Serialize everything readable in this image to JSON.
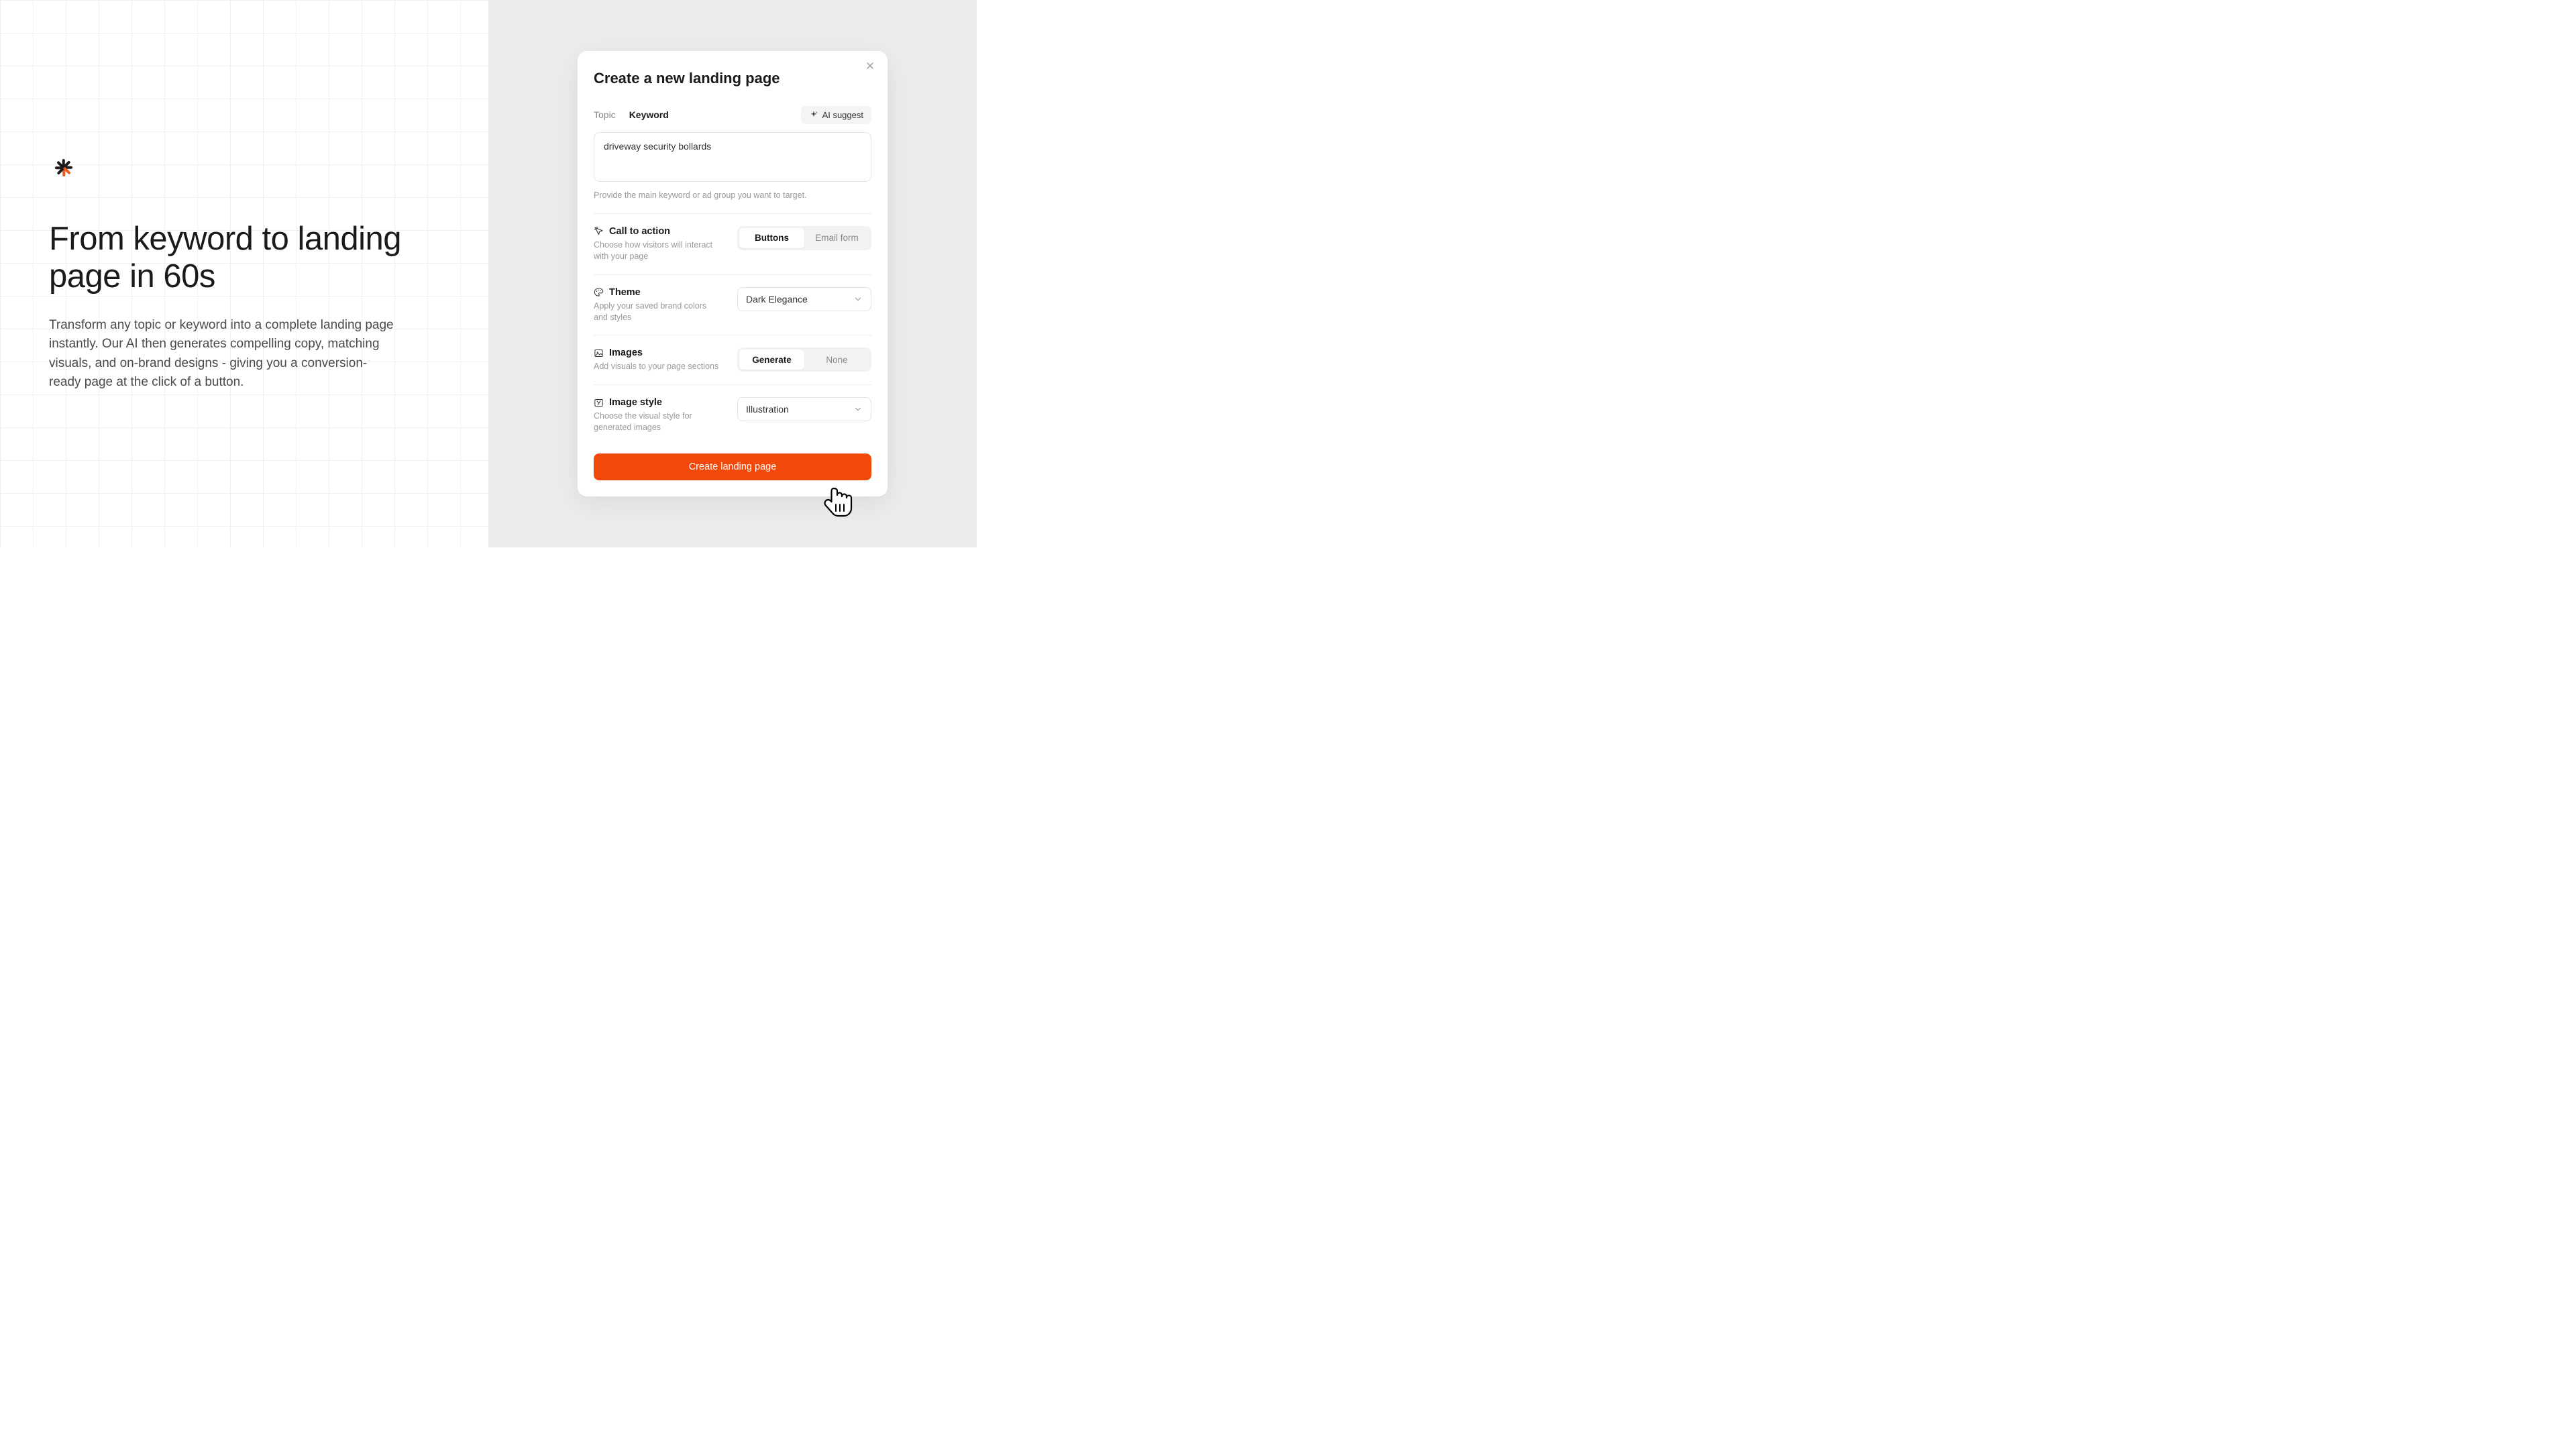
{
  "hero": {
    "heading": "From keyword to landing page in 60s",
    "body": "Transform any topic or keyword into a complete landing page instantly. Our AI then generates compelling copy, matching visuals, and on-brand designs - giving you a conversion-ready page at the click of a button."
  },
  "modal": {
    "title": "Create a new landing page",
    "tabs": {
      "topic": "Topic",
      "keyword": "Keyword"
    },
    "ai_suggest": "AI suggest",
    "keyword_value": "driveway security bollards",
    "keyword_helper": "Provide the main keyword or ad group you want to target.",
    "cta": {
      "label": "Call to action",
      "desc": "Choose how visitors will interact with your page",
      "opt_buttons": "Buttons",
      "opt_email": "Email form"
    },
    "theme": {
      "label": "Theme",
      "desc": "Apply your saved brand colors and styles",
      "selected": "Dark Elegance"
    },
    "images": {
      "label": "Images",
      "desc": "Add visuals to your page sections",
      "opt_generate": "Generate",
      "opt_none": "None"
    },
    "image_style": {
      "label": "Image style",
      "desc": "Choose the visual style for generated images",
      "selected": "Illustration"
    },
    "submit": "Create landing page"
  },
  "colors": {
    "accent": "#f0490b"
  }
}
